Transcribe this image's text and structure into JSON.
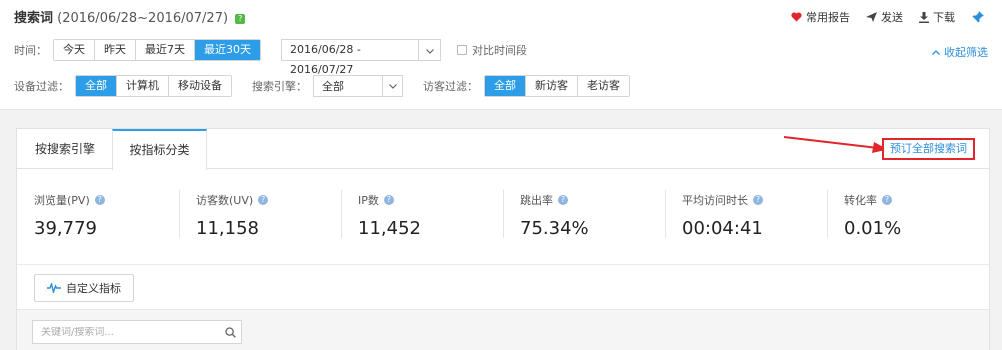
{
  "header": {
    "title": "搜索词",
    "range": "(2016/06/28~2016/07/27)",
    "help": "?"
  },
  "actions": {
    "favorites": "常用报告",
    "send": "发送",
    "download": "下载"
  },
  "time": {
    "label": "时间：",
    "options": [
      "今天",
      "昨天",
      "最近7天",
      "最近30天"
    ],
    "active": "最近30天",
    "date_range": "2016/06/28 - 2016/07/27",
    "compare_label": "对比时间段",
    "collapse_label": "收起筛选"
  },
  "filters": {
    "device_label": "设备过滤：",
    "device_options": [
      "全部",
      "计算机",
      "移动设备"
    ],
    "engine_label": "搜索引擎：",
    "engine_value": "全部",
    "visitor_label": "访客过滤：",
    "visitor_options": [
      "全部",
      "新访客",
      "老访客"
    ]
  },
  "tabs": {
    "by_engine": "按搜索引擎",
    "by_metric": "按指标分类",
    "subscribe": "预订全部搜索词"
  },
  "metrics": [
    {
      "name": "浏览量(PV)",
      "value": "39,779"
    },
    {
      "name": "访客数(UV)",
      "value": "11,158"
    },
    {
      "name": "IP数",
      "value": "11,452"
    },
    {
      "name": "跳出率",
      "value": "75.34%"
    },
    {
      "name": "平均访问时长",
      "value": "00:04:41"
    },
    {
      "name": "转化率",
      "value": "0.01%"
    }
  ],
  "custom": {
    "label": "自定义指标"
  },
  "search": {
    "placeholder": "关键词/搜索词..."
  },
  "colors": {
    "accent": "#2d9de8",
    "link": "#2d8fd8",
    "highlight": "#e0262b",
    "help_green": "#52b848"
  }
}
